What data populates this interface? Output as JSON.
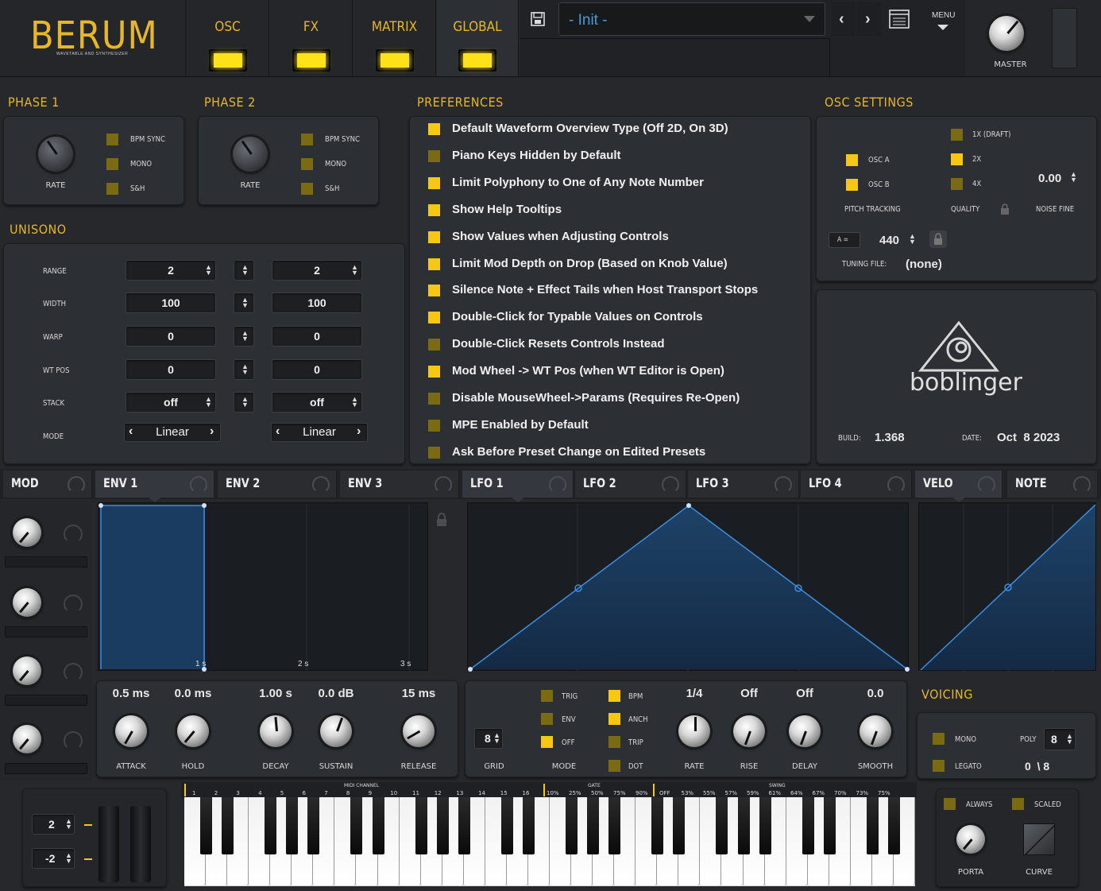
{
  "logo": {
    "title": "BERUM",
    "subtitle": "WAVETABLE AND SYNTHESIZER"
  },
  "top_tabs": [
    "OSC",
    "FX",
    "MATRIX",
    "GLOBAL"
  ],
  "preset": {
    "name": "- Init -",
    "menu_label": "MENU",
    "master_label": "MASTER"
  },
  "phase1": {
    "title": "PHASE 1",
    "rate_label": "RATE",
    "options": [
      "BPM SYNC",
      "MONO",
      "S&H"
    ]
  },
  "phase2": {
    "title": "PHASE 2",
    "rate_label": "RATE",
    "options": [
      "BPM SYNC",
      "MONO",
      "S&H"
    ]
  },
  "unisono": {
    "title": "UNISONO",
    "rows": [
      {
        "label": "RANGE",
        "a": "2",
        "b": "2"
      },
      {
        "label": "WIDTH",
        "a": "100",
        "b": "100"
      },
      {
        "label": "WARP",
        "a": "0",
        "b": "0"
      },
      {
        "label": "WT POS",
        "a": "0",
        "b": "0"
      },
      {
        "label": "STACK",
        "a": "off",
        "b": "off"
      },
      {
        "label": "MODE",
        "a": "Linear",
        "b": "Linear"
      }
    ]
  },
  "preferences": {
    "title": "PREFERENCES",
    "items": [
      {
        "label": "Default Waveform Overview Type (Off 2D, On 3D)",
        "on": true
      },
      {
        "label": "Piano Keys Hidden by Default",
        "on": false
      },
      {
        "label": "Limit Polyphony to One of Any Note Number",
        "on": true
      },
      {
        "label": "Show Help Tooltips",
        "on": true
      },
      {
        "label": "Show Values when Adjusting Controls",
        "on": true
      },
      {
        "label": "Limit Mod Depth on Drop (Based on Knob Value)",
        "on": true
      },
      {
        "label": "Silence Note + Effect Tails when Host Transport Stops",
        "on": true
      },
      {
        "label": "Double-Click for Typable Values on Controls",
        "on": true
      },
      {
        "label": "Double-Click Resets Controls Instead",
        "on": false
      },
      {
        "label": "Mod Wheel -> WT Pos (when WT Editor is Open)",
        "on": true
      },
      {
        "label": "Disable MouseWheel->Params (Requires Re-Open)",
        "on": false
      },
      {
        "label": "MPE Enabled by Default",
        "on": false
      },
      {
        "label": "Ask Before Preset Change on Edited Presets",
        "on": false
      }
    ]
  },
  "osc_settings": {
    "title": "OSC SETTINGS",
    "osc_a": "OSC A",
    "osc_b": "OSC B",
    "q1": "1X (DRAFT)",
    "q2": "2X",
    "q3": "4X",
    "noise_value": "0.00",
    "pitch_tracking": "PITCH TRACKING",
    "quality": "QUALITY",
    "noise_fine": "NOISE FINE",
    "a_label": "A =",
    "a_value": "440",
    "tuning_label": "TUNING FILE:",
    "tuning_value": "(none)"
  },
  "about": {
    "brand": "boblinger",
    "build_label": "BUILD:",
    "build": "1.368",
    "date_label": "DATE:",
    "date": "Oct  8 2023"
  },
  "mod_tabs": [
    "MOD",
    "ENV 1",
    "ENV 2",
    "ENV 3",
    "LFO 1",
    "LFO 2",
    "LFO 3",
    "LFO 4",
    "VELO",
    "NOTE"
  ],
  "env": {
    "time_labels": [
      "1 s",
      "2 s",
      "3 s"
    ],
    "values": [
      "0.5 ms",
      "0.0 ms",
      "1.00 s",
      "0.0 dB",
      "15 ms"
    ],
    "labels": [
      "ATTACK",
      "HOLD",
      "DECAY",
      "SUSTAIN",
      "RELEASE"
    ]
  },
  "lfo": {
    "grid_value": "8",
    "grid_label": "GRID",
    "mode_label": "MODE",
    "mode_opts": [
      "TRIG",
      "ENV",
      "OFF"
    ],
    "flags": [
      "BPM",
      "ANCH",
      "TRIP",
      "DOT"
    ],
    "values": [
      "1/4",
      "Off",
      "Off",
      "0.0"
    ],
    "labels": [
      "RATE",
      "RISE",
      "DELAY",
      "SMOOTH"
    ]
  },
  "voicing": {
    "title": "VOICING",
    "mono": "MONO",
    "legato": "LEGATO",
    "poly_label": "POLY",
    "poly": "8",
    "count": "0  \\ 8"
  },
  "bottom_left": {
    "up": "2",
    "down": "-2"
  },
  "keyboard_strip": {
    "midi_label": "MIDI CHANNEL",
    "midi": [
      "1",
      "2",
      "3",
      "4",
      "5",
      "6",
      "7",
      "8",
      "9",
      "10",
      "11",
      "12",
      "13",
      "14",
      "15",
      "16"
    ],
    "gate_label": "GATE",
    "gate": [
      "10%",
      "25%",
      "50%",
      "75%",
      "90%"
    ],
    "swing_label": "SWING",
    "swing": [
      "OFF",
      "53%",
      "55%",
      "57%",
      "59%",
      "61%",
      "64%",
      "67%",
      "70%",
      "73%",
      "75%"
    ]
  },
  "portamento": {
    "always": "ALWAYS",
    "scaled": "SCALED",
    "porta": "PORTA",
    "curve": "CURVE"
  },
  "colors": {
    "accent": "#e8b726",
    "led": "#fde21a",
    "graph_line": "#3a8fe0"
  }
}
